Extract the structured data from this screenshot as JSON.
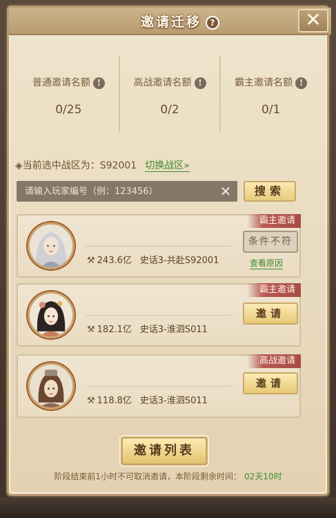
{
  "header": {
    "title": "邀请迁移",
    "help_icon": "?",
    "close_icon": "✕"
  },
  "quotas": [
    {
      "label": "普通邀请名额",
      "value": "0/25"
    },
    {
      "label": "高战邀请名额",
      "value": "0/2"
    },
    {
      "label": "霸主邀请名额",
      "value": "0/1"
    }
  ],
  "zone": {
    "current_label": "◈当前选中战区为：S92001",
    "switch_label": "切换战区»"
  },
  "search": {
    "placeholder": "请输入玩家编号（例：123456）",
    "clear_icon": "✕",
    "button_label": "搜索"
  },
  "players": [
    {
      "tag": "霸主邀请",
      "power": "243.6亿",
      "server": "史话3-共赴S92001",
      "action": "条件不符",
      "reason_link": "查看原因",
      "avatar": "white-haired-character"
    },
    {
      "tag": "霸主邀请",
      "power": "182.1亿",
      "server": "史话3-淮泗S011",
      "action": "邀请",
      "avatar": "dark-haired-lady"
    },
    {
      "tag": "高战邀请",
      "power": "118.8亿",
      "server": "史话3-淮泗S011",
      "action": "邀请",
      "avatar": "young-warrior"
    }
  ],
  "footer": {
    "list_button": "邀请列表",
    "note": "阶段结束前1小时不可取消邀请，本阶段剩余时间：",
    "time_left": "02天10时"
  },
  "colors": {
    "accent_green": "#3e8a32",
    "tag_red": "#b75a54",
    "button_gold": "#e8c977"
  }
}
